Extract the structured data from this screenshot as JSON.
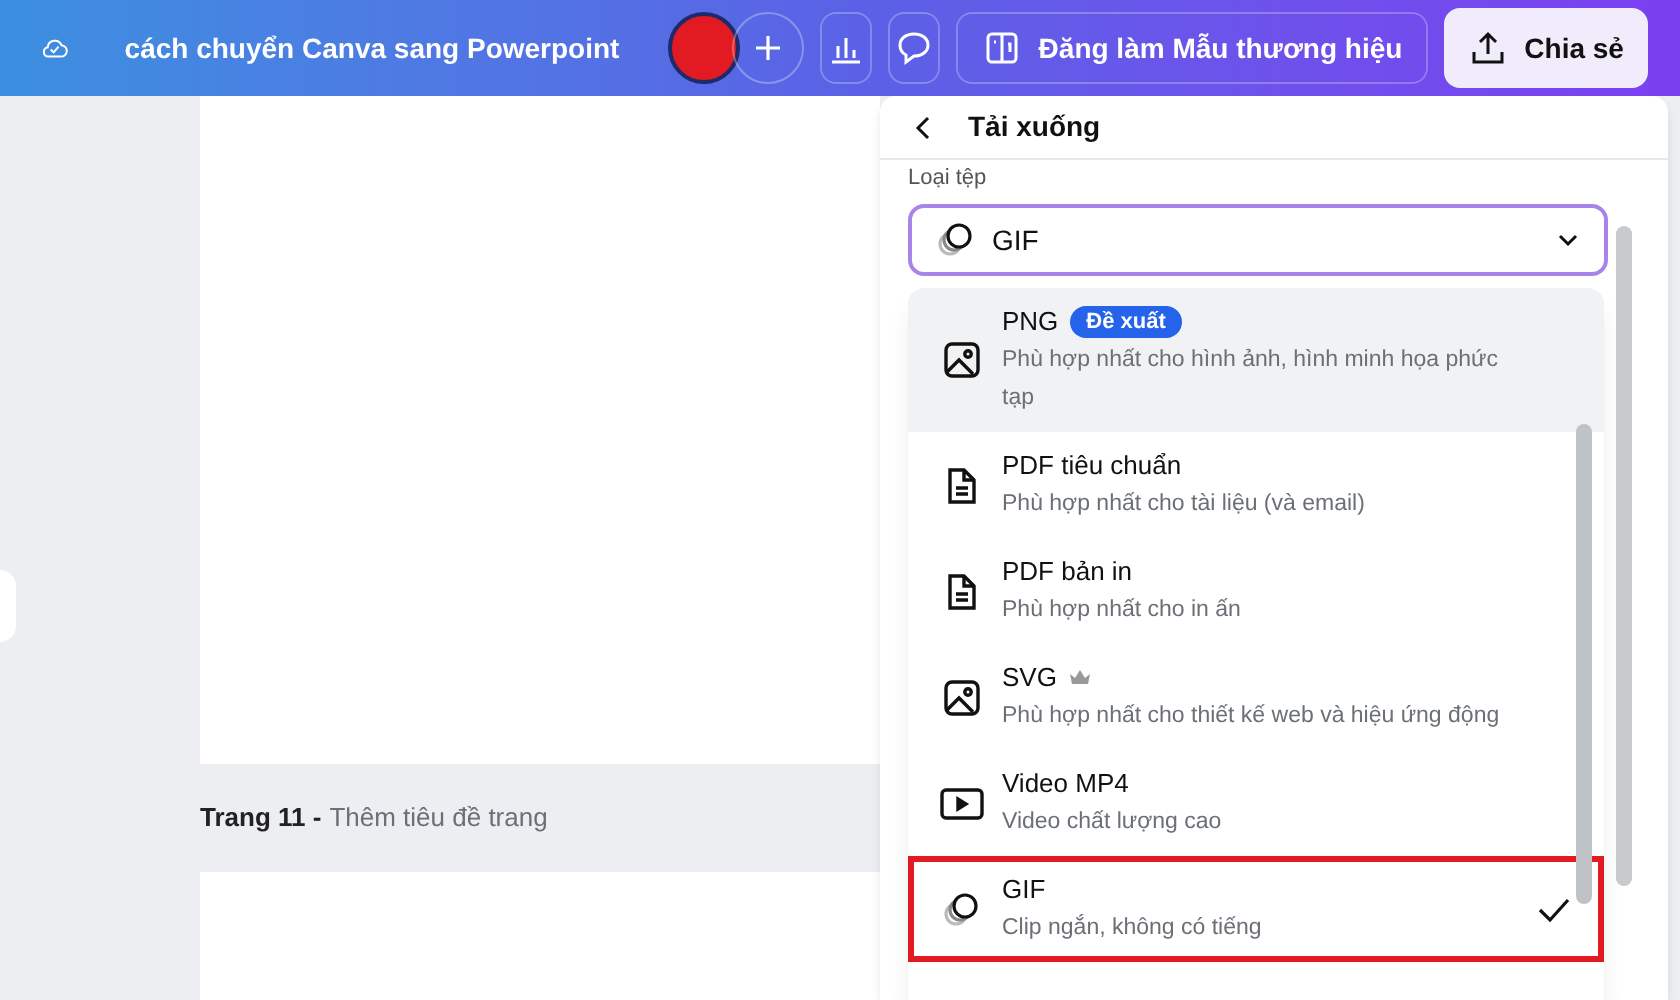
{
  "top_bar": {
    "title": "cách chuyển Canva sang Powerpoint",
    "brand_template_button": "Đăng làm Mẫu thương hiệu",
    "share_button": "Chia sẻ"
  },
  "page_label": {
    "number": "Trang 11 -",
    "title": "Thêm tiêu đề trang"
  },
  "download_panel": {
    "title": "Tải xuống",
    "file_type_label": "Loại tệp",
    "file_type_value": "GIF",
    "options": [
      {
        "kind": "image",
        "name": "PNG",
        "badge": "Đề xuất",
        "description": "Phù hợp nhất cho hình ảnh, hình minh họa phức tạp",
        "premium": false,
        "hovered": true,
        "selected": false,
        "annotated": false
      },
      {
        "kind": "document",
        "name": "PDF tiêu chuẩn",
        "description": "Phù hợp nhất cho tài liệu (và email)",
        "premium": false,
        "hovered": false,
        "selected": false,
        "annotated": false
      },
      {
        "kind": "document",
        "name": "PDF bản in",
        "description": "Phù hợp nhất cho in ấn",
        "premium": false,
        "hovered": false,
        "selected": false,
        "annotated": false
      },
      {
        "kind": "image",
        "name": "SVG",
        "description": "Phù hợp nhất cho thiết kế web và hiệu ứng động",
        "premium": true,
        "hovered": false,
        "selected": false,
        "annotated": false
      },
      {
        "kind": "video",
        "name": "Video MP4",
        "description": "Video chất lượng cao",
        "premium": false,
        "hovered": false,
        "selected": false,
        "annotated": false
      },
      {
        "kind": "gif",
        "name": "GIF",
        "description": "Clip ngắn, không có tiếng",
        "premium": false,
        "hovered": false,
        "selected": true,
        "annotated": true
      }
    ]
  }
}
